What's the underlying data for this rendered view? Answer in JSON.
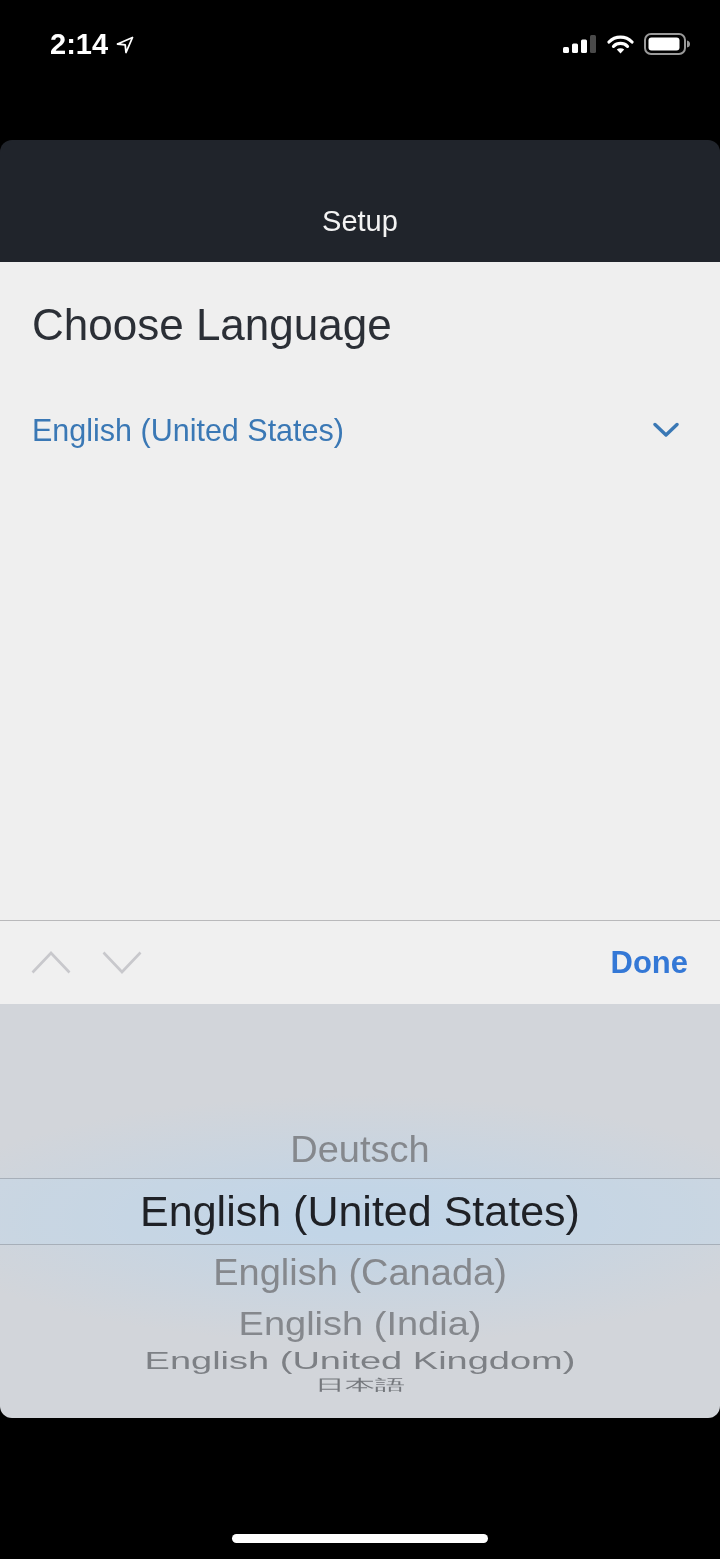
{
  "status_bar": {
    "time": "2:14"
  },
  "header": {
    "title": "Setup"
  },
  "page": {
    "heading": "Choose Language",
    "language_dropdown": {
      "value": "English (United States)"
    }
  },
  "toolbar": {
    "previous": {
      "disabled": true
    },
    "next": {
      "disabled": true
    },
    "done_label": "Done"
  },
  "picker": {
    "options": [
      {
        "label": "Deutsch",
        "selected": false
      },
      {
        "label": "English (United States)",
        "selected": true
      },
      {
        "label": "English (Canada)",
        "selected": false
      },
      {
        "label": "English (India)",
        "selected": false
      },
      {
        "label": "English (United Kingdom)",
        "selected": false
      },
      {
        "label": "日本語",
        "selected": false
      }
    ]
  }
}
